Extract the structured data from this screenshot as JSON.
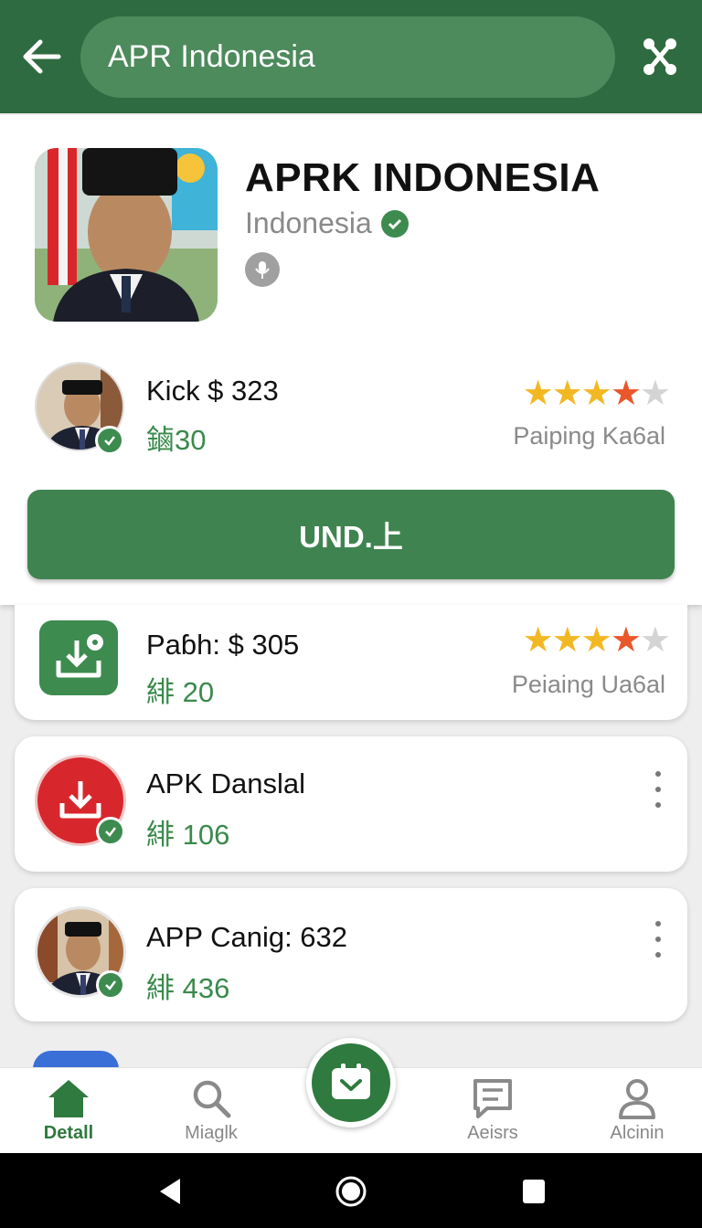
{
  "topbar": {
    "search_text": "APR Indonesia",
    "back_icon": "arrow-left-icon",
    "share_icon": "share-nodes-icon"
  },
  "header": {
    "title": "APRK INDONESIA",
    "subtitle": "Indonesia",
    "featured": {
      "title": "Kick $ 323",
      "sub": "鏀30",
      "rating": 3.5,
      "rating_label": "Paiping Ka6al"
    },
    "main_button": "UND.上"
  },
  "list": [
    {
      "title": "Paɓh: $ 305",
      "sub": "緋 20",
      "rating": 3.5,
      "rating_label": "Peiaing Ua6al",
      "icon": "download-square-icon"
    },
    {
      "title": "APK Danslal",
      "sub": "緋 106",
      "icon": "download-circle-icon"
    },
    {
      "title": "APP Canig: 632",
      "sub": "緋 436",
      "icon": "avatar"
    }
  ],
  "bottom_nav": [
    {
      "label": "Detall",
      "icon": "home-icon",
      "active": true
    },
    {
      "label": "Miaglk",
      "icon": "search-icon",
      "active": false
    },
    {
      "label": "Aeisrs",
      "icon": "message-icon",
      "active": false
    },
    {
      "label": "Alcinin",
      "icon": "person-icon",
      "active": false
    }
  ],
  "colors": {
    "primary": "#2f6b40",
    "accent": "#3f8450",
    "star_gold": "#f2b824",
    "star_orange": "#e9572a"
  }
}
